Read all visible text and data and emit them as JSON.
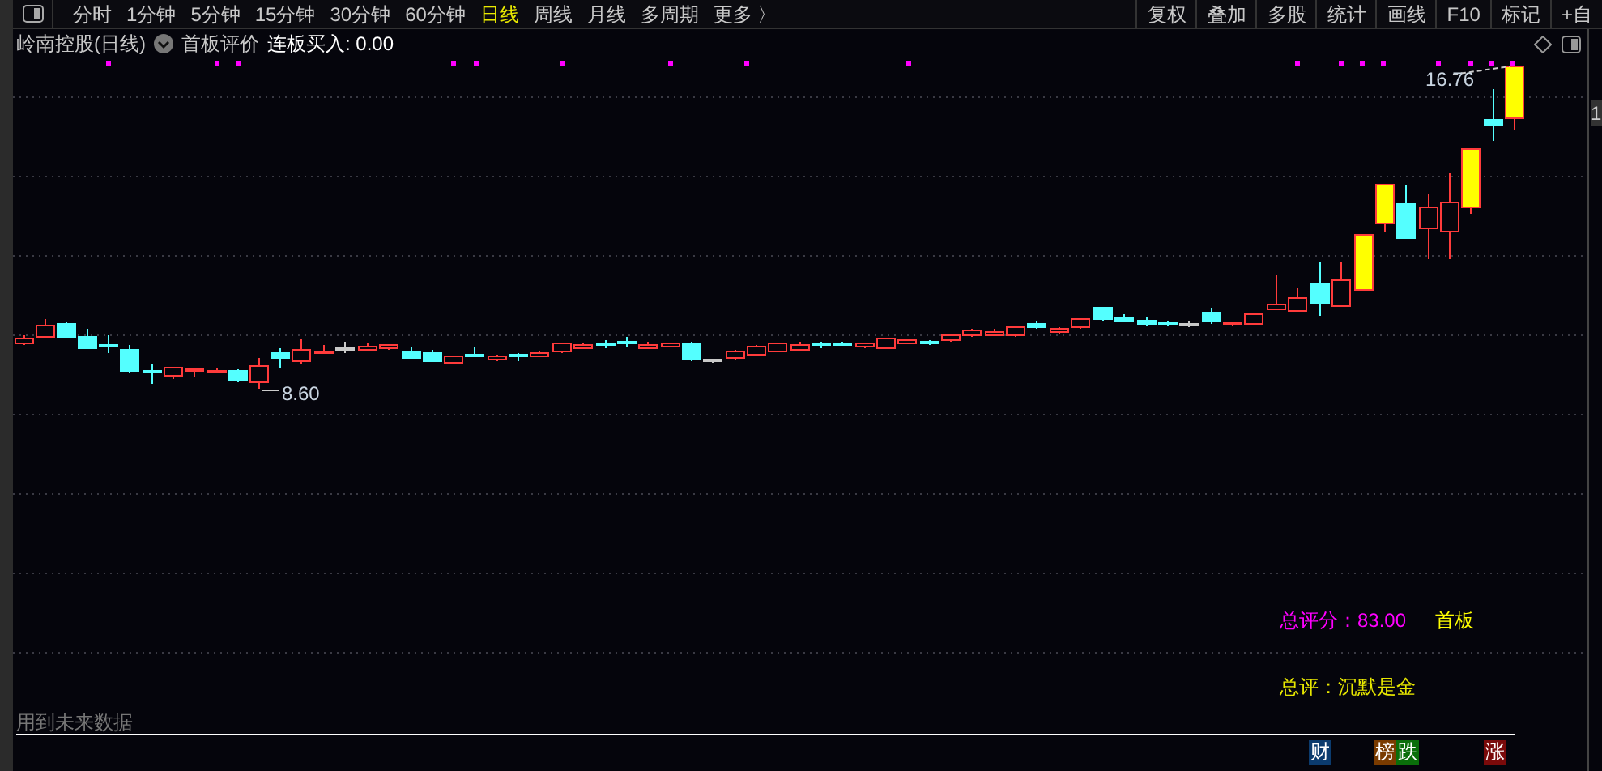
{
  "toolbar": {
    "periods": [
      {
        "label": "分时",
        "selected": false
      },
      {
        "label": "1分钟",
        "selected": false
      },
      {
        "label": "5分钟",
        "selected": false
      },
      {
        "label": "15分钟",
        "selected": false
      },
      {
        "label": "30分钟",
        "selected": false
      },
      {
        "label": "60分钟",
        "selected": false
      },
      {
        "label": "日线",
        "selected": true
      },
      {
        "label": "周线",
        "selected": false
      },
      {
        "label": "月线",
        "selected": false
      },
      {
        "label": "多周期",
        "selected": false
      }
    ],
    "more": "更多",
    "more_arrow": "〉",
    "tools": [
      "复权",
      "叠加",
      "多股",
      "统计",
      "画线",
      "F10",
      "标记",
      "+自"
    ]
  },
  "header": {
    "title": "岭南控股(日线)",
    "indicator": "首板评价",
    "readout": "连板买入: 0.00"
  },
  "chart": {
    "high_label": "16.76",
    "low_label": "8.60",
    "axis_label": "1"
  },
  "score": {
    "label": "总评分：",
    "value": "83.00",
    "tag": "首板",
    "verdict": "总评：沉默是金"
  },
  "footer": {
    "note": "用到未来数据",
    "badges": [
      {
        "label": "财",
        "color": "#0b3b6e"
      },
      {
        "label": "榜",
        "color": "#7a3b00"
      },
      {
        "label": "跌",
        "color": "#0a6e0a"
      },
      {
        "label": "涨",
        "color": "#7a0a0a"
      }
    ]
  }
}
